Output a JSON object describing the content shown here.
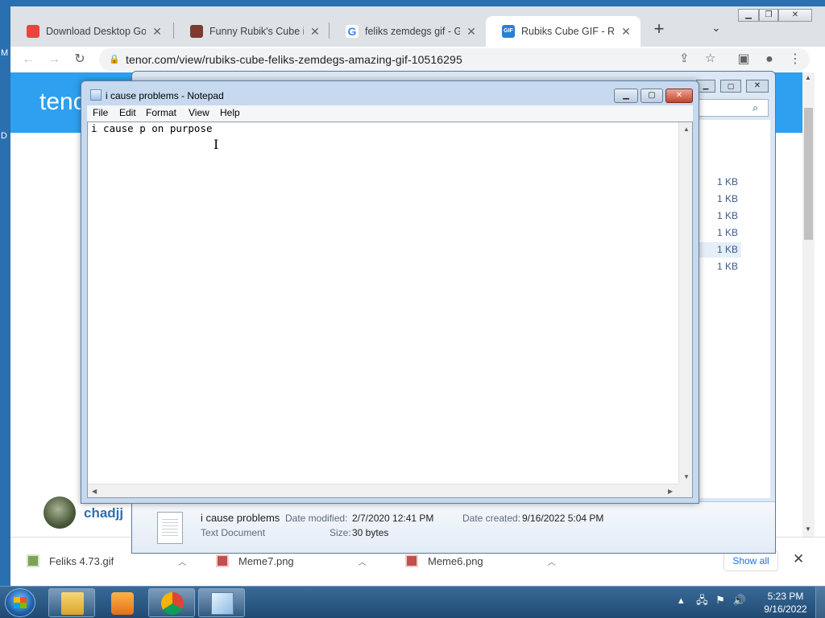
{
  "browser": {
    "tabs": [
      {
        "title": "Download Desktop Goo",
        "favicon_color": "#e8453c"
      },
      {
        "title": "Funny Rubik's Cube ima",
        "favicon_color": "#7a3b2e"
      },
      {
        "title": "feliks zemdegs gif - Goo",
        "favicon_color": "#4285f4"
      },
      {
        "title": "Rubiks Cube GIF - Rubik",
        "favicon_color": "#2b7fd6"
      }
    ],
    "url": "tenor.com/view/rubiks-cube-feliks-zemdegs-amazing-gif-10516295",
    "page": {
      "logo": "tenor",
      "username": "chadjj"
    },
    "downloads": [
      {
        "name": "Feliks 4.73.gif"
      },
      {
        "name": "Meme7.png"
      },
      {
        "name": "Meme6.png"
      }
    ],
    "show_all": "Show all"
  },
  "explorer": {
    "sizes": [
      "1 KB",
      "1 KB",
      "1 KB",
      "1 KB",
      "1 KB",
      "1 KB"
    ],
    "selected_row": 4,
    "details": {
      "name": "i cause problems",
      "type": "Text Document",
      "modified_label": "Date modified:",
      "modified_value": "2/7/2020 12:41 PM",
      "created_label": "Date created:",
      "created_value": "9/16/2022 5:04 PM",
      "size_label": "Size:",
      "size_value": "30 bytes"
    }
  },
  "notepad": {
    "title": "i cause problems - Notepad",
    "menu": [
      "File",
      "Edit",
      "Format",
      "View",
      "Help"
    ],
    "text": "i cause p on purpose"
  },
  "taskbar": {
    "time": "5:23 PM",
    "date": "9/16/2022"
  },
  "colors": {
    "tenor_blue": "#2ea0ef",
    "chrome_tabstrip": "#dee1e6",
    "taskbar": "#1f4a73"
  }
}
